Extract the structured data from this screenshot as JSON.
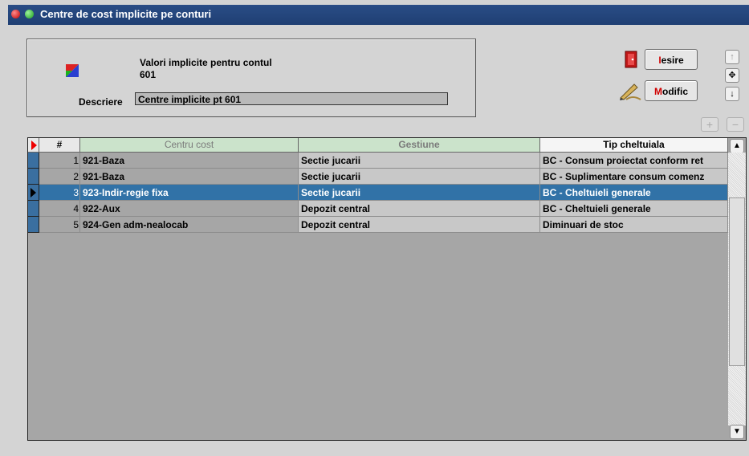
{
  "window": {
    "title": "Centre de cost implicite pe conturi"
  },
  "info": {
    "line1": "Valori implicite pentru contul",
    "account": "601",
    "description_label": "Descriere",
    "description_value": "Centre implicite pt 601"
  },
  "buttons": {
    "exit_hot": "I",
    "exit_rest": "esire",
    "modify_hot": "M",
    "modify_rest": "odific"
  },
  "grid": {
    "columns": [
      "#",
      "Centru cost",
      "Gestiune",
      "Tip cheltuiala"
    ],
    "rows": [
      {
        "n": "1",
        "centru": "921-Baza",
        "gestiune": "Sectie jucarii",
        "tip": "BC - Consum proiectat conform ret"
      },
      {
        "n": "2",
        "centru": "921-Baza",
        "gestiune": "Sectie jucarii",
        "tip": "BC - Suplimentare consum comenz"
      },
      {
        "n": "3",
        "centru": "923-Indir-regie fixa",
        "gestiune": "Sectie jucarii",
        "tip": "BC - Cheltuieli generale"
      },
      {
        "n": "4",
        "centru": "922-Aux",
        "gestiune": "Depozit central",
        "tip": "BC - Cheltuieli generale"
      },
      {
        "n": "5",
        "centru": "924-Gen adm-nealocab",
        "gestiune": "Depozit central",
        "tip": "Diminuari de stoc"
      }
    ]
  },
  "colors": {
    "title_bar": "#2a4d86",
    "selection": "#3172a7",
    "hotkey": "#d00000"
  },
  "icons": [
    "close-dot-icon",
    "minimize-dot-icon",
    "logo-icon",
    "exit-door-icon",
    "edit-pen-icon",
    "arrow-up-icon",
    "move-icon",
    "arrow-down-icon",
    "plus-icon",
    "minus-icon"
  ]
}
